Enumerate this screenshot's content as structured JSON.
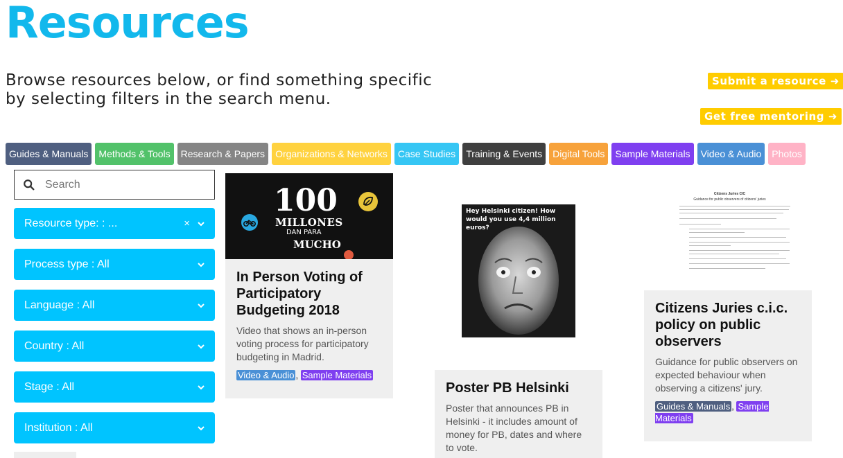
{
  "page": {
    "title": "Resources",
    "subtitle": "Browse resources below, or find something specific by selecting filters in the search menu."
  },
  "actions": {
    "submit_label": "Submit a resource ➜",
    "mentor_label": "Get free mentoring ➜"
  },
  "categories": [
    {
      "label": "Guides & Manuals",
      "color": "#4f5f80"
    },
    {
      "label": "Methods & Tools",
      "color": "#52c26a"
    },
    {
      "label": "Research & Papers",
      "color": "#858585"
    },
    {
      "label": "Organizations & Networks",
      "color": "#ffd23f"
    },
    {
      "label": "Case Studies",
      "color": "#36c6f4"
    },
    {
      "label": "Training & Events",
      "color": "#3f3f3f"
    },
    {
      "label": "Digital Tools",
      "color": "#f7a23b"
    },
    {
      "label": "Sample Materials",
      "color": "#7f3ff0"
    },
    {
      "label": "Video & Audio",
      "color": "#4a90d6"
    },
    {
      "label": "Photos",
      "color": "#ffb3c6"
    }
  ],
  "search": {
    "placeholder": "Search",
    "value": ""
  },
  "filters": {
    "resource_type": "Resource type: : ...",
    "process_type": "Process type : All",
    "language": "Language : All",
    "country": "Country : All",
    "stage": "Stage : All",
    "institution": "Institution : All",
    "clear_icon": "×"
  },
  "cards": [
    {
      "title": "In Person Voting of Participatory Budgeting 2018",
      "description": "Video that shows an in-person voting process for participatory budgeting in Madrid.",
      "tags": [
        "Video & Audio",
        "Sample Materials"
      ],
      "image_text": {
        "big": "100",
        "line1": "MILLONES",
        "line2": "DAN PARA",
        "line3": "MUCHO"
      }
    },
    {
      "title": "Poster PB Helsinki",
      "description": "Poster that announces PB in Helsinki - it includes amount of money for PB, dates and where to vote.",
      "tags": [],
      "image_text": {
        "headline": "Hey Helsinki citizen! How would you use 4,4 million euros?"
      }
    },
    {
      "title": "Citizens Juries c.i.c. policy on public observers",
      "description": "Guidance for public observers on expected behaviour when observing a citizens' jury.",
      "tags": [
        "Guides & Manuals",
        "Sample Materials"
      ],
      "image_text": {
        "heading1": "Citizens Juries CIC",
        "heading2": "Guidance for public observers of citizens' juries"
      }
    }
  ]
}
